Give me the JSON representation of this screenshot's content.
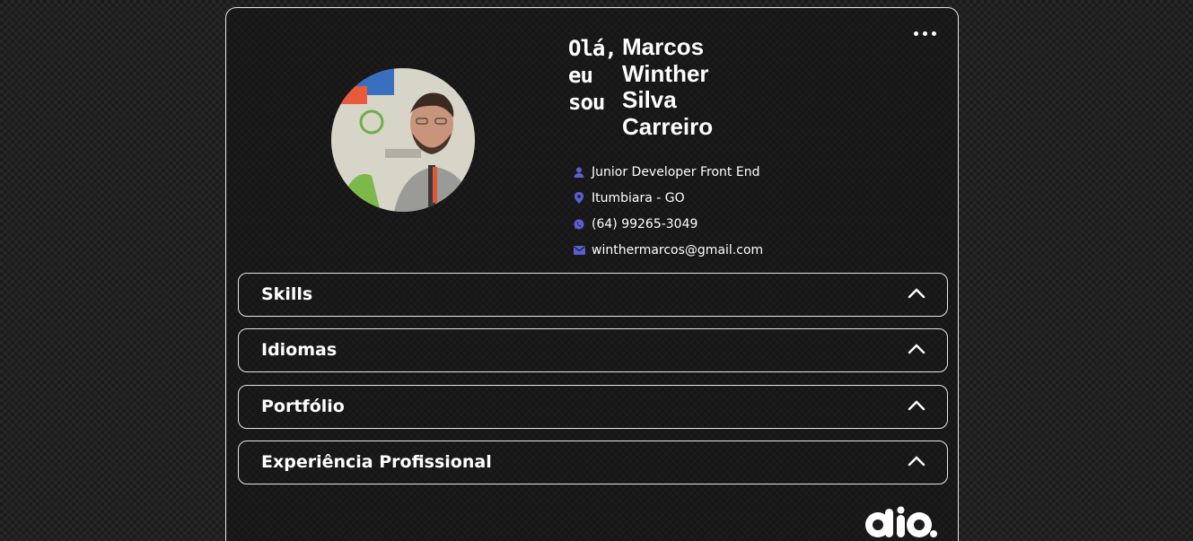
{
  "profile": {
    "greeting_lines": [
      "Olá,",
      "eu",
      "sou"
    ],
    "name_lines": [
      "Marcos",
      "Winther",
      "Silva",
      "Carreiro"
    ],
    "info": [
      {
        "icon": "user-icon",
        "text": "Junior Developer Front End"
      },
      {
        "icon": "location-pin-icon",
        "text": "Itumbiara - GO"
      },
      {
        "icon": "whatsapp-icon",
        "text": "(64) 99265-3049"
      },
      {
        "icon": "email-icon",
        "text": "winthermarcos@gmail.com"
      }
    ]
  },
  "sections": [
    {
      "title": "Skills"
    },
    {
      "title": "Idiomas"
    },
    {
      "title": "Portfólio"
    },
    {
      "title": "Experiência Profissional"
    }
  ],
  "colors": {
    "icon_accent": "#5b5fd1",
    "border": "#e6e6e6",
    "text": "#ffffff"
  },
  "logo": {
    "text": "dio."
  }
}
